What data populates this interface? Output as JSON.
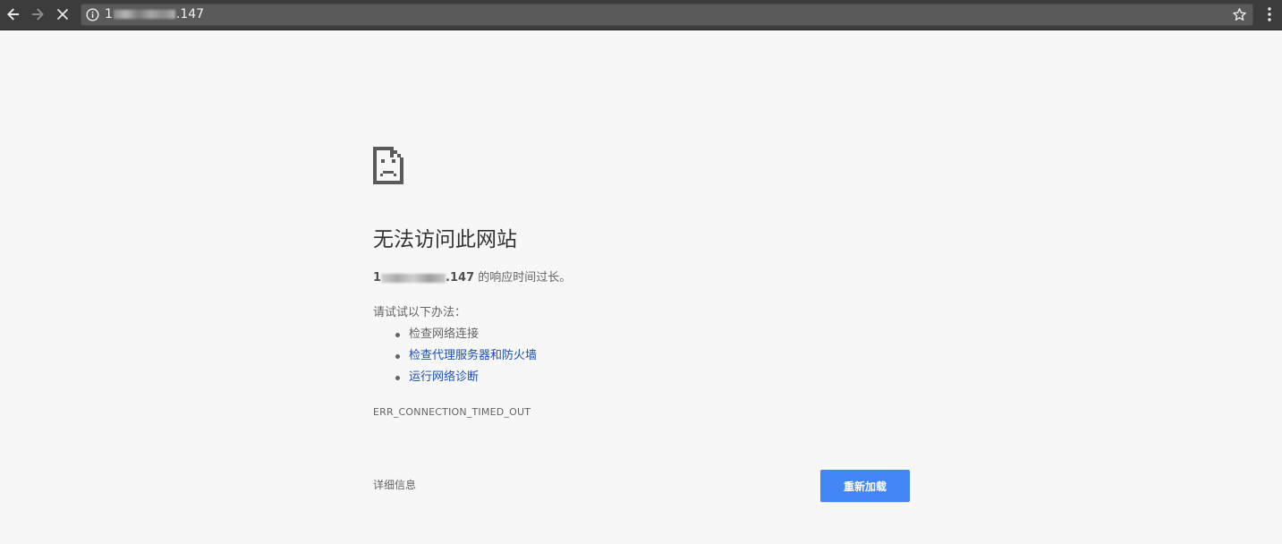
{
  "browser": {
    "url_prefix": "1",
    "url_suffix": ".147",
    "back_icon": "arrow-left-icon",
    "forward_icon": "arrow-right-icon",
    "stop_icon": "close-icon",
    "info_icon": "info-icon",
    "bookmark_icon": "star-icon",
    "menu_icon": "more-vertical-icon"
  },
  "page": {
    "icon": "sad-page-icon",
    "title": "无法访问此网站",
    "summary_host_prefix": "1",
    "summary_host_suffix": ".147",
    "summary_text": " 的响应时间过长。",
    "try_label": "请试试以下办法：",
    "suggestions": [
      {
        "label": "检查网络连接",
        "link": false
      },
      {
        "label": "检查代理服务器和防火墙",
        "link": true
      },
      {
        "label": "运行网络诊断",
        "link": true
      }
    ],
    "error_code": "ERR_CONNECTION_TIMED_OUT",
    "details_label": "详细信息",
    "reload_label": "重新加载",
    "accent_color": "#4285f4",
    "link_color": "#1a4fbd"
  }
}
